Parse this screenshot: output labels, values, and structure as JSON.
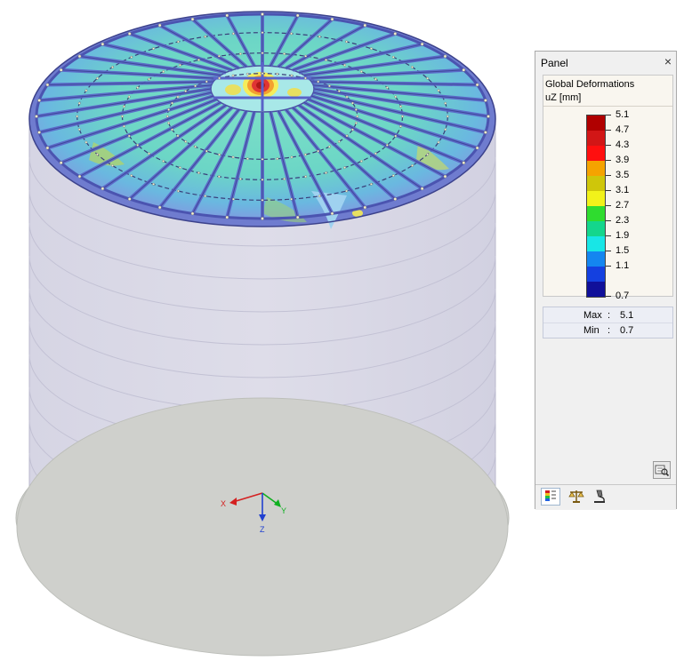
{
  "panel": {
    "title": "Panel",
    "close_glyph": "×",
    "legend_title": "Global Deformations",
    "legend_unit": "uZ [mm]",
    "scale_colors": [
      "#b00000",
      "#d21616",
      "#ff0f0f",
      "#f5a300",
      "#cfc60a",
      "#f2f21a",
      "#2fdc2f",
      "#14d68c",
      "#18e6e6",
      "#1486f0",
      "#1440e0",
      "#10109a"
    ],
    "scale_labels": [
      "5.1",
      "4.7",
      "4.3",
      "3.9",
      "3.5",
      "3.1",
      "2.7",
      "2.3",
      "1.9",
      "1.5",
      "1.1",
      "0.7"
    ],
    "max_label": "Max",
    "max_value": "5.1",
    "min_label": "Min",
    "min_value": "0.7",
    "colon": ":",
    "toolbar_icons": [
      "color-scale-icon",
      "balance-icon",
      "microscope-icon"
    ],
    "settings_icon": "zoom-settings-icon"
  },
  "viewport": {
    "axis_x_label": "X",
    "axis_y_label": "Y",
    "axis_z_label": "Z",
    "axis_colors": {
      "x": "#d42020",
      "y": "#10b020",
      "z": "#2040d0"
    }
  }
}
